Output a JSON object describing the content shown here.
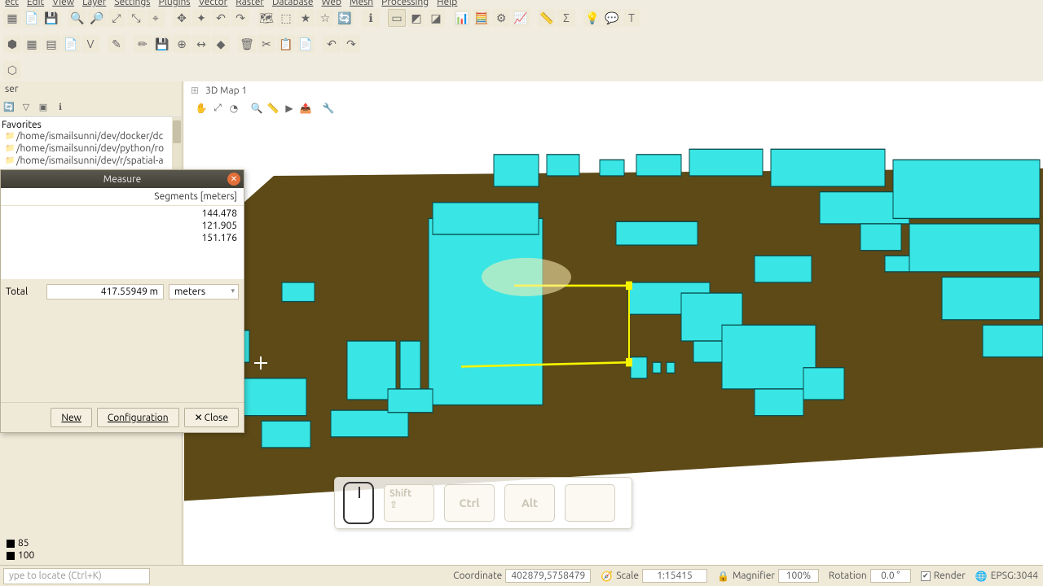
{
  "menu": {
    "items": [
      "ect",
      "Edit",
      "View",
      "Layer",
      "Settings",
      "Plugins",
      "Vector",
      "Raster",
      "Database",
      "Web",
      "Mesh",
      "Processing",
      "Help"
    ]
  },
  "browser": {
    "title": "ser",
    "favorites_label": "Favorites",
    "paths": [
      "/home/ismailsunni/dev/docker/dc",
      "/home/ismailsunni/dev/python/ro",
      "/home/ismailsunni/dev/r/spatial-a"
    ]
  },
  "layers": [
    {
      "label": "85"
    },
    {
      "label": "100"
    }
  ],
  "view3d": {
    "title": "3D Map 1"
  },
  "measure": {
    "title": "Measure",
    "segments_header": "Segments [meters]",
    "segments": [
      "144.478",
      "121.905",
      "151.176"
    ],
    "total_label": "Total",
    "total_value": "417.55949 m",
    "unit": "meters",
    "new": "New",
    "config": "Configuration",
    "close": "Close"
  },
  "keys": {
    "shift": "Shift",
    "ctrl": "Ctrl",
    "alt": "Alt"
  },
  "status": {
    "locate_placeholder": "ype to locate (Ctrl+K)",
    "coord_label": "Coordinate",
    "coord_value": "402879,5758479",
    "scale_label": "Scale",
    "scale_value": "1:15415",
    "mag_label": "Magnifier",
    "mag_value": "100%",
    "rot_label": "Rotation",
    "rot_value": "0.0 °",
    "render": "Render",
    "crs": "EPSG:3044"
  }
}
